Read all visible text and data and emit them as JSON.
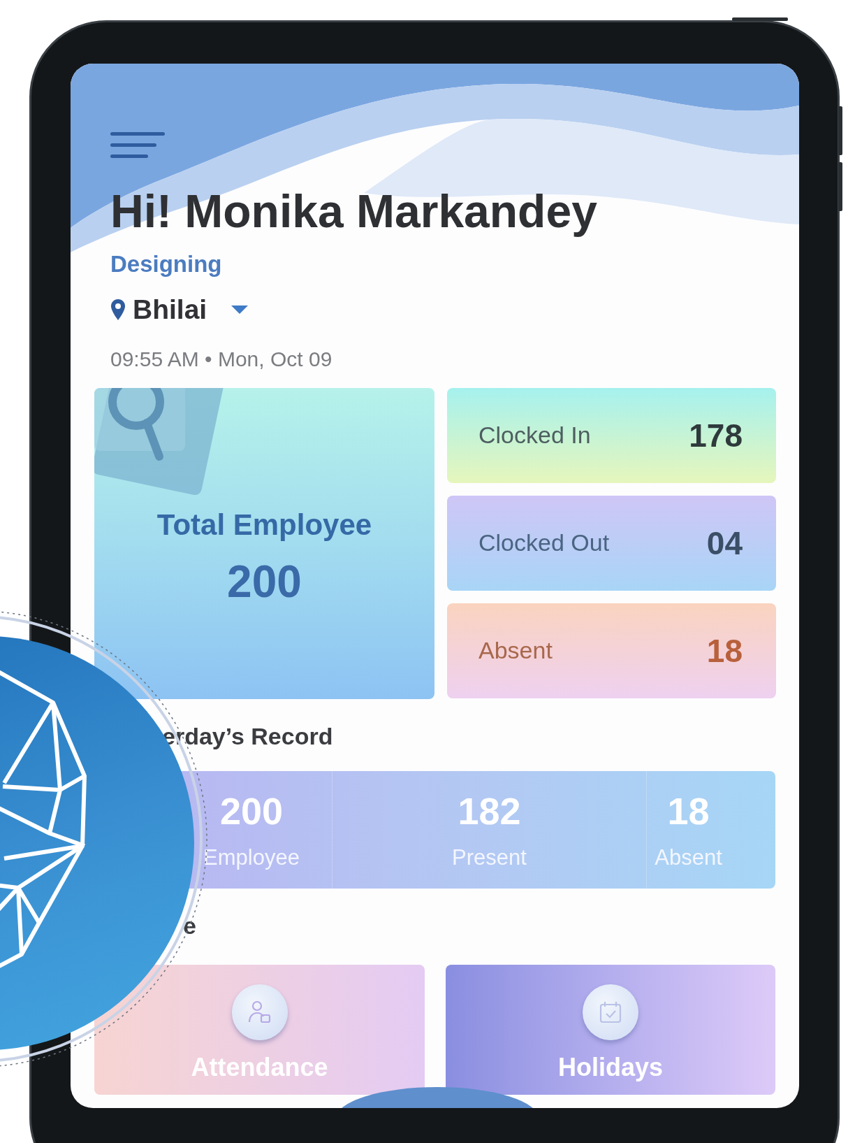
{
  "header": {
    "greeting": "Hi! Monika Markandey",
    "department": "Designing",
    "location": "Bhilai",
    "datetime": "09:55 AM • Mon, Oct 09"
  },
  "summary": {
    "total": {
      "label": "Total Employee",
      "value": "200"
    },
    "stats": [
      {
        "label": "Clocked In",
        "value": "178",
        "kind": "clocked_in"
      },
      {
        "label": "Clocked Out",
        "value": "04",
        "kind": "clocked_out"
      },
      {
        "label": "Absent",
        "value": "18",
        "kind": "absent"
      }
    ]
  },
  "record": {
    "title": "erday’s Record",
    "items": [
      {
        "value": "200",
        "label": "Employee"
      },
      {
        "value": "182",
        "label": "Present"
      },
      {
        "value": "18",
        "label": "Absent"
      }
    ]
  },
  "features": {
    "title": "e",
    "items": [
      {
        "label": "Attendance",
        "kind": "attendance"
      },
      {
        "label": "Holidays",
        "kind": "holidays"
      }
    ]
  }
}
